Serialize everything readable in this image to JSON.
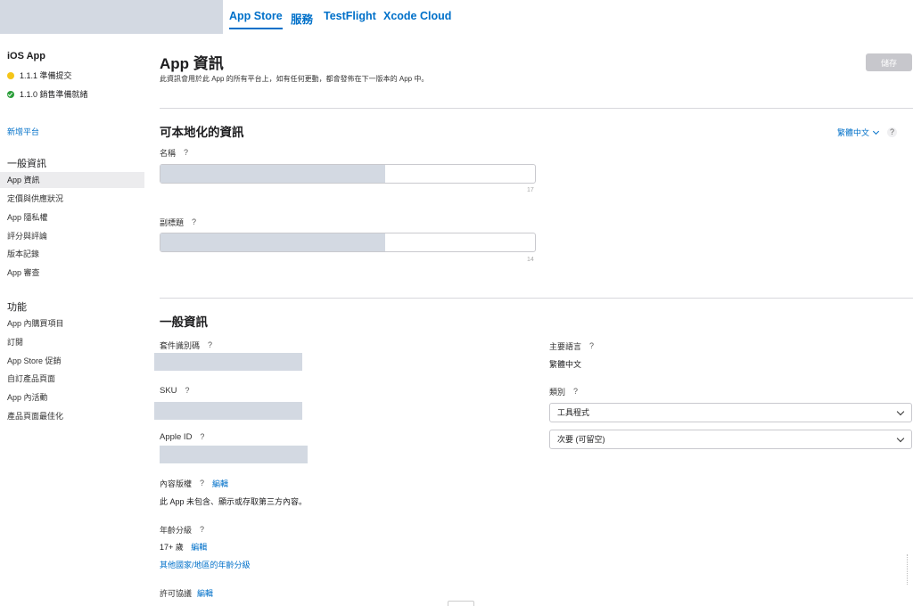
{
  "topnav": {
    "tabs": [
      {
        "label": "App Store",
        "active": true
      },
      {
        "label": "服務",
        "active": false
      },
      {
        "label": "TestFlight",
        "active": false
      },
      {
        "label": "Xcode Cloud",
        "active": false
      }
    ]
  },
  "sidebar": {
    "platform_title": "iOS App",
    "versions": [
      {
        "label": "1.1.1 準備提交",
        "status_color": "#f5c518"
      },
      {
        "label": "1.1.0 銷售準備就緒",
        "status_color": "#2b9e3a"
      }
    ],
    "add_platform": "新增平台",
    "general_heading": "一般資訊",
    "general_items": [
      "App 資訊",
      "定價與供應狀況",
      "App 隱私權",
      "評分與評論",
      "版本記錄",
      "App 審查"
    ],
    "features_heading": "功能",
    "feature_items": [
      "App 內購買項目",
      "訂閱",
      "App Store 促銷",
      "自訂產品頁面",
      "App 內活動",
      "產品頁面最佳化"
    ]
  },
  "header": {
    "title": "App 資訊",
    "description": "此資訊會用於此 App 的所有平台上，如有任何更動，都會發佈在下一版本的 App 中。",
    "save_label": "儲存"
  },
  "localizable": {
    "title": "可本地化的資訊",
    "language": "繁體中文",
    "name_label": "名稱",
    "name_counter": "17",
    "subtitle_label": "副標題",
    "subtitle_counter": "14"
  },
  "general": {
    "title": "一般資訊",
    "bundle_id_label": "套件識別碼",
    "sku_label": "SKU",
    "apple_id_label": "Apple ID",
    "content_rights_label": "內容版權",
    "content_rights_edit": "編輯",
    "content_rights_value": "此 App 未包含、顯示或存取第三方內容。",
    "age_rating_label": "年齡分級",
    "age_rating_value": "17+ 歲",
    "age_rating_edit": "編輯",
    "age_rating_other": "其他國家/地區的年齡分級",
    "license_label": "許可協議",
    "license_edit": "編輯",
    "primary_language_label": "主要語言",
    "primary_language_value": "繁體中文",
    "category_label": "類別",
    "primary_category": "工具程式",
    "secondary_category": "次要 (可留空)"
  },
  "help_glyph": "?",
  "colors": {
    "accent": "#0070c9",
    "redaction": "#d3d9e2"
  }
}
